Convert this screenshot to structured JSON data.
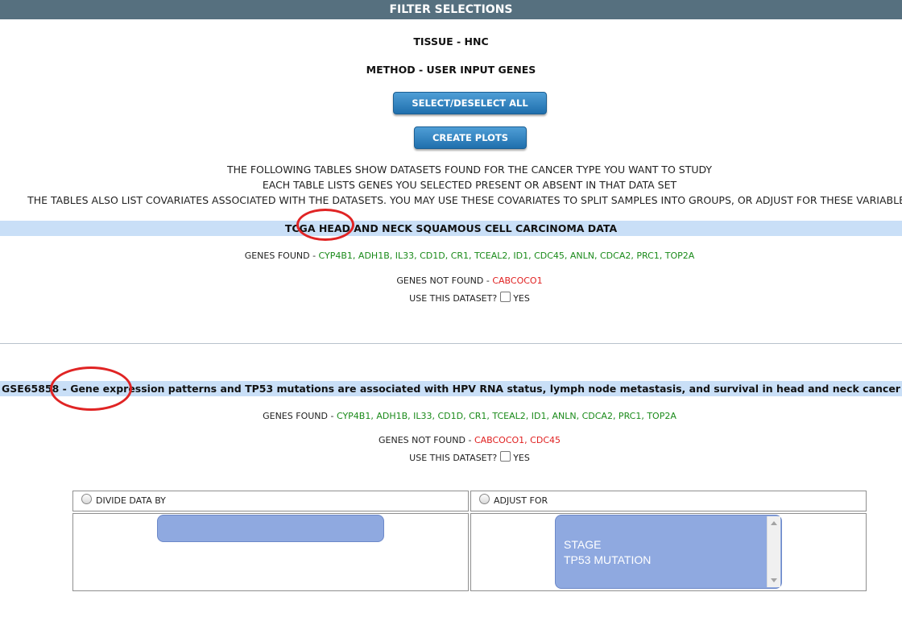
{
  "header": {
    "title": "FILTER SELECTIONS"
  },
  "filters": {
    "tissue": "TISSUE - HNC",
    "method": "METHOD - USER INPUT GENES"
  },
  "buttons": {
    "select_all": "SELECT/DESELECT ALL",
    "create_plots": "CREATE PLOTS"
  },
  "info": {
    "line1": "THE FOLLOWING TABLES SHOW DATASETS FOUND FOR THE CANCER TYPE YOU WANT TO STUDY",
    "line2": "EACH TABLE LISTS GENES YOU SELECTED PRESENT OR ABSENT IN THAT DATA SET",
    "line3": "THE TABLES ALSO LIST COVARIATES ASSOCIATED WITH THE DATASETS. YOU MAY USE THESE COVARIATES TO SPLIT SAMPLES INTO GROUPS, OR ADJUST FOR THESE VARIABLES"
  },
  "datasets": [
    {
      "title": "TCGA HEAD AND NECK SQUAMOUS CELL CARCINOMA DATA",
      "genes_found_label": "GENES FOUND - ",
      "genes_found": "CYP4B1, ADH1B, IL33, CD1D, CR1, TCEAL2, ID1, CDC45, ANLN, CDCA2, PRC1, TOP2A",
      "genes_not_found_label": "GENES NOT FOUND - ",
      "genes_not_found": "CABCOCO1",
      "use_label": "USE THIS DATASET?",
      "yes_label": "YES"
    },
    {
      "title": "GSE65858 - Gene expression patterns and TP53 mutations are associated with HPV RNA status, lymph node metastasis, and survival in head and neck cancer",
      "genes_found_label": "GENES FOUND - ",
      "genes_found": "CYP4B1, ADH1B, IL33, CD1D, CR1, TCEAL2, ID1, ANLN, CDCA2, PRC1, TOP2A",
      "genes_not_found_label": "GENES NOT FOUND - ",
      "genes_not_found": "CABCOCO1, CDC45",
      "use_label": "USE THIS DATASET?",
      "yes_label": "YES"
    }
  ],
  "covariates": {
    "divide_label": "DIVIDE DATA BY",
    "adjust_label": "ADJUST FOR",
    "adjust_options": [
      "STAGE",
      "TP53 MUTATION"
    ]
  },
  "colors": {
    "header_bg": "#56707f",
    "dataset_bar": "#c9dff7",
    "found": "#1a8a1a",
    "not_found": "#e02020",
    "annotation_circle": "#e02424",
    "select_bg": "#8fa9e0"
  }
}
